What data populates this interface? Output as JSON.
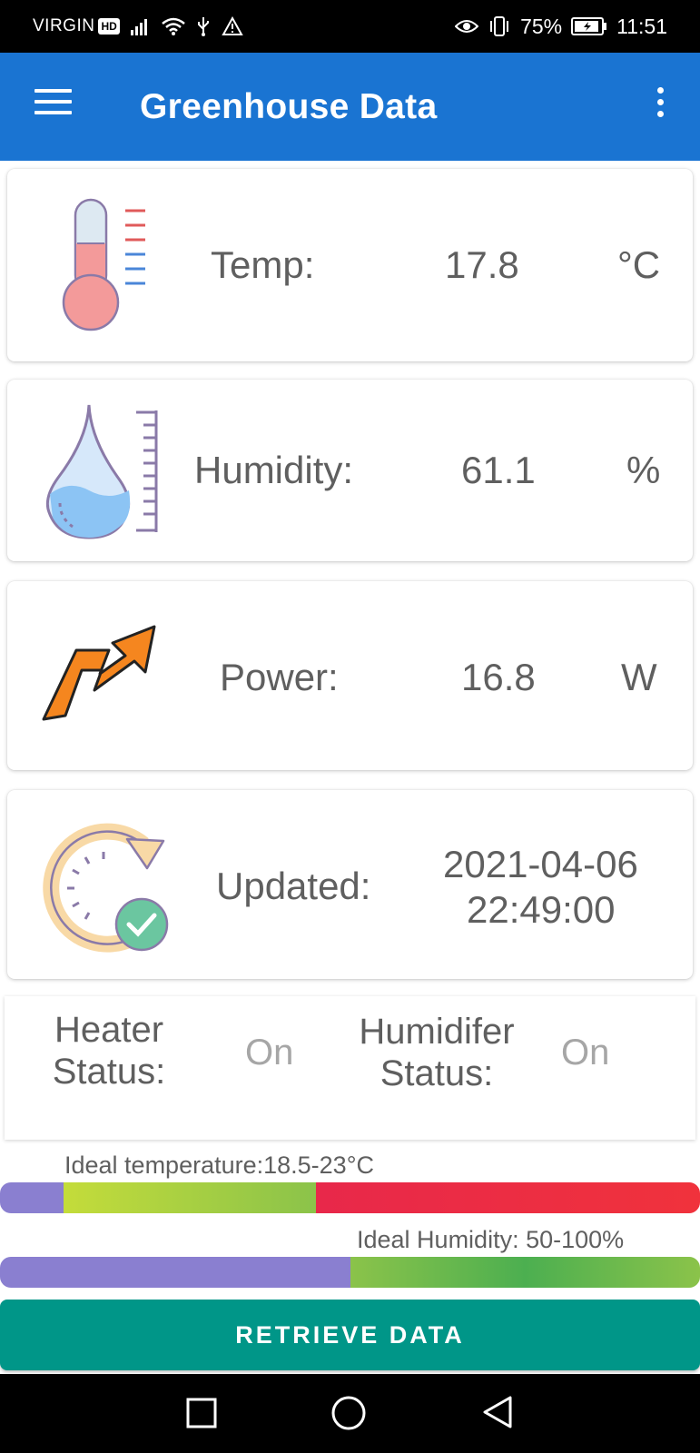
{
  "status_bar": {
    "carrier": "VIRGIN",
    "hd_badge": "HD",
    "battery": "75%",
    "time": "11:51"
  },
  "app_bar": {
    "title": "Greenhouse Data"
  },
  "readings": {
    "temp": {
      "label": "Temp:",
      "value": "17.8",
      "unit": "°C",
      "icon": "thermometer-icon"
    },
    "humidity": {
      "label": "Humidity:",
      "value": "61.1",
      "unit": "%",
      "icon": "water-drop-icon"
    },
    "power": {
      "label": "Power:",
      "value": "16.8",
      "unit": "W",
      "icon": "power-arrow-icon"
    },
    "updated": {
      "label": "Updated:",
      "date": "2021-04-06",
      "time": "22:49:00",
      "icon": "refresh-check-icon"
    }
  },
  "status": {
    "heater_label_1": "Heater",
    "heater_label_2": "Status:",
    "heater_value": "On",
    "humidifier_label_1": "Humidifer",
    "humidifier_label_2": "Status:",
    "humidifier_value": "On"
  },
  "ideal": {
    "temperature": "Ideal temperature:18.5-23°C",
    "humidity": "Ideal Humidity: 50-100%"
  },
  "colors": {
    "app_bar": "#1a74d2",
    "button": "#009688",
    "bar_low": "#8a7fd0",
    "bar_ok": "#8bc34a",
    "bar_high": "#ef2a4a"
  },
  "actions": {
    "retrieve": "RETRIEVE DATA"
  },
  "nav": {
    "recent": "square-icon",
    "home": "circle-icon",
    "back": "triangle-back-icon"
  }
}
